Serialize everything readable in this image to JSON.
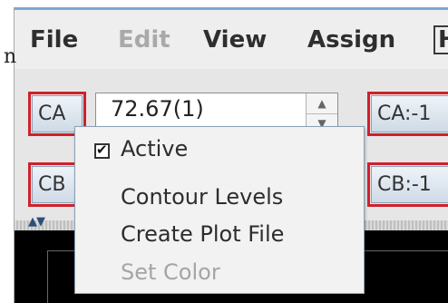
{
  "menubar": {
    "items": [
      {
        "label": "File"
      },
      {
        "label": "Edit"
      },
      {
        "label": "View"
      },
      {
        "label": "Assign"
      },
      {
        "label": "H"
      }
    ]
  },
  "outer_glyph": "n",
  "panel": {
    "ca_button": "CA",
    "cb_button": "CB",
    "ca_value": "72.67(1)",
    "ca_right_button": "CA:-1",
    "cb_right_button": "CB:-1"
  },
  "context_menu": {
    "active": {
      "label": "Active",
      "checked": true,
      "check_glyph": "✔"
    },
    "contour_levels": "Contour Levels",
    "create_plot_file": "Create Plot File",
    "set_color": "Set Color"
  },
  "colors": {
    "highlight_frame": "#d0202a",
    "menubar_bg": "#eeeeee",
    "canvas_bg": "#000000"
  }
}
